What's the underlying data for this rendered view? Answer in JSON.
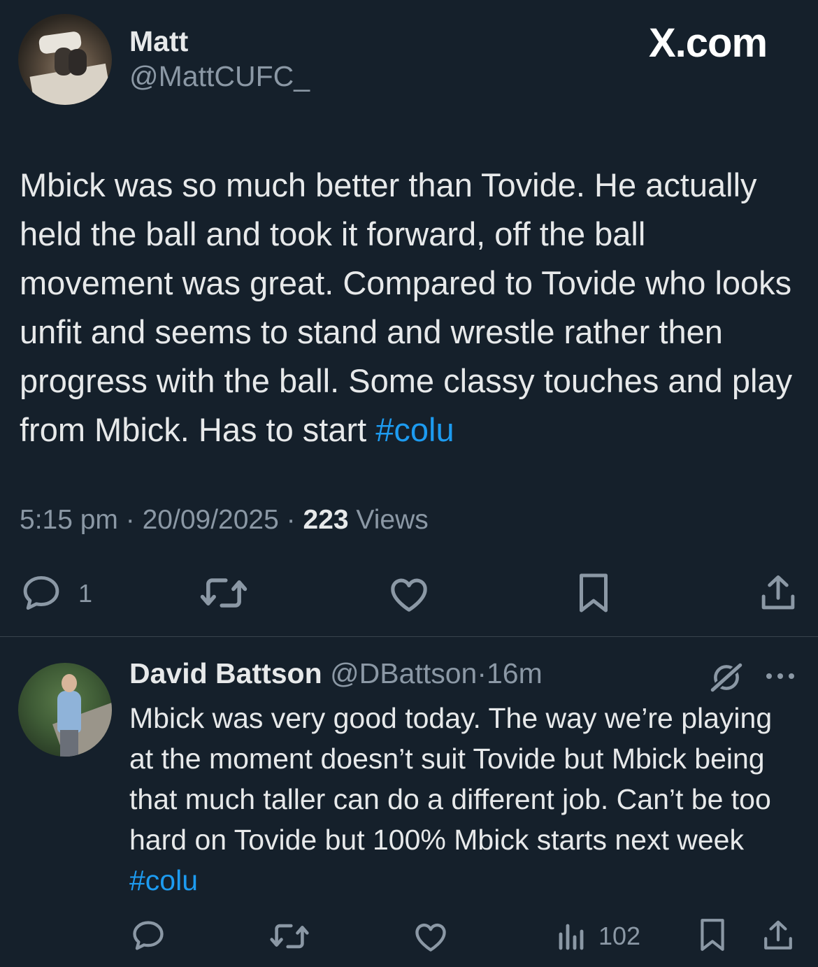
{
  "main_tweet": {
    "display_name": "Matt",
    "handle": "@MattCUFC_",
    "site_label": "X.com",
    "text": "Mbick was so much better than Tovide. He actually held the ball and took it forward, off the ball movement was great. Compared to Tovide who looks unfit and seems to stand and wrestle rather then progress with the ball. Some classy touches and play from Mbick. Has to start",
    "hashtag": "#colu",
    "time": "5:15 pm",
    "date": "20/09/2025",
    "views_count": "223",
    "views_label": "Views",
    "reply_count": "1",
    "separator": "·"
  },
  "reply": {
    "display_name": "David Battson",
    "handle": "@DBattson",
    "time_ago": "16m",
    "separator": "·",
    "text": "Mbick was very good today. The way we’re playing at the moment doesn’t suit Tovide but Mbick being that much taller can do a different job. Can’t be too hard on Tovide but 100% Mbick starts next week",
    "hashtag": "#colu",
    "views_count": "102"
  },
  "icons": {
    "reply": "reply-icon",
    "retweet": "retweet-icon",
    "like": "like-icon",
    "bookmark": "bookmark-icon",
    "share": "share-icon",
    "views": "views-icon",
    "grok": "grok-icon",
    "more": "more-icon"
  },
  "colors": {
    "background": "#15202b",
    "text": "#e7e9ea",
    "secondary": "#8b98a5",
    "link": "#1d9bf0",
    "divider": "#38444d"
  }
}
